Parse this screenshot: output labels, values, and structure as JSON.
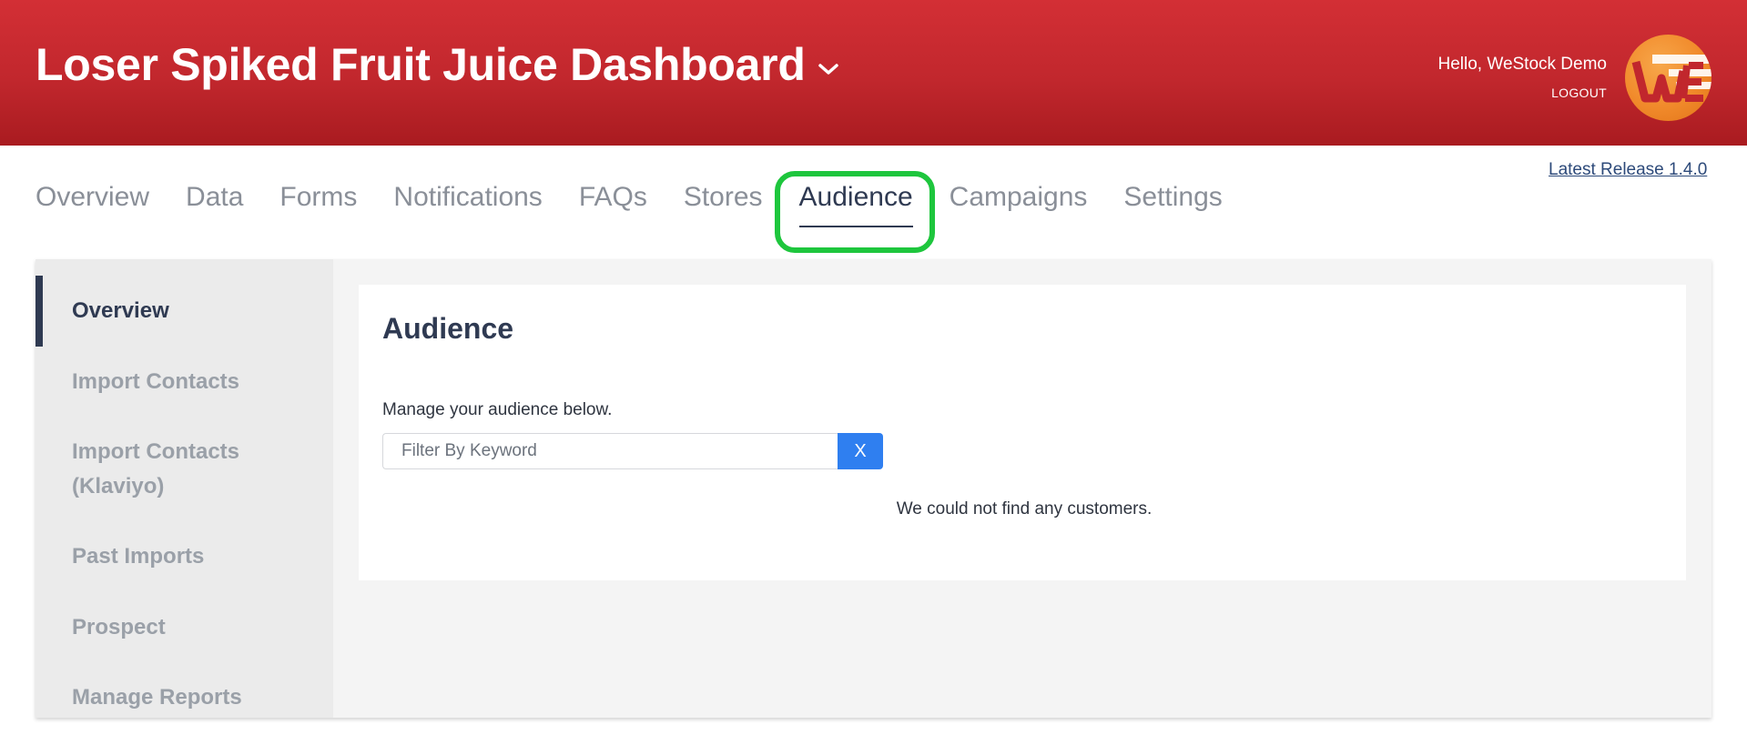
{
  "header": {
    "title": "Loser Spiked Fruit Juice Dashboard",
    "greeting": "Hello, WeStock Demo",
    "logout": "LOGOUT",
    "brand_color": "#c1272d"
  },
  "release": {
    "label": "Latest Release 1.4.0"
  },
  "tabs": [
    {
      "label": "Overview"
    },
    {
      "label": "Data"
    },
    {
      "label": "Forms"
    },
    {
      "label": "Notifications"
    },
    {
      "label": "FAQs"
    },
    {
      "label": "Stores"
    },
    {
      "label": "Audience",
      "active": true
    },
    {
      "label": "Campaigns"
    },
    {
      "label": "Settings"
    }
  ],
  "sidebar": {
    "items": [
      {
        "label": "Overview",
        "active": true
      },
      {
        "label": "Import Contacts"
      },
      {
        "label": "Import Contacts (Klaviyo)"
      },
      {
        "label": "Past Imports"
      },
      {
        "label": "Prospect"
      },
      {
        "label": "Manage Reports"
      }
    ]
  },
  "main": {
    "title": "Audience",
    "description": "Manage your audience below.",
    "filter": {
      "placeholder": "Filter By Keyword",
      "value": "",
      "clear_label": "X"
    },
    "empty_message": "We could not find any customers."
  },
  "colors": {
    "accent": "#2f7ff0",
    "highlight": "#1ec63d",
    "text_dark": "#2f3a52"
  }
}
